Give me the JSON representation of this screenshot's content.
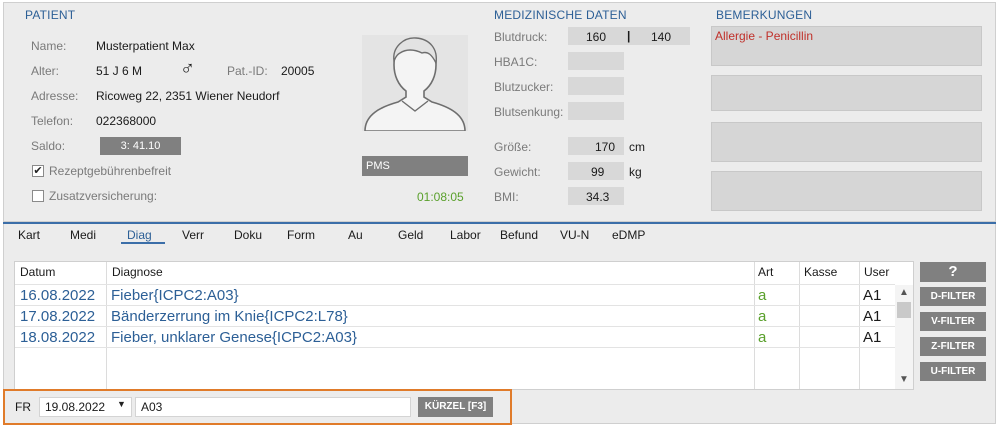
{
  "patient": {
    "section_title": "PATIENT",
    "name_label": "Name:",
    "name_value": "Musterpatient Max",
    "age_label": "Alter:",
    "age_value": "51 J 6 M",
    "gender_symbol": "♂",
    "patid_label": "Pat.-ID:",
    "patid_value": "20005",
    "address_label": "Adresse:",
    "address_value": "Ricoweg 22, 2351 Wiener Neudorf",
    "phone_label": "Telefon:",
    "phone_value": "022368000",
    "saldo_label": "Saldo:",
    "saldo_value": "3: 41.10",
    "rezept_checked": "✔",
    "rezept_label": "Rezeptgebührenbefreit",
    "zusatz_label": "Zusatzversicherung:",
    "pms_label": "PMS",
    "timer": "01:08:05"
  },
  "medical": {
    "section_title": "MEDIZINISCHE DATEN",
    "bp_label": "Blutdruck:",
    "bp_sys": "160",
    "bp_sep": "|",
    "bp_dia": "140",
    "hba1c_label": "HBA1C:",
    "sugar_label": "Blutzucker:",
    "sed_label": "Blutsenkung:",
    "height_label": "Größe:",
    "height_value": "170",
    "height_unit": "cm",
    "weight_label": "Gewicht:",
    "weight_value": "99",
    "weight_unit": "kg",
    "bmi_label": "BMI:",
    "bmi_value": "34.3"
  },
  "remarks": {
    "section_title": "BEMERKUNGEN",
    "box1": "Allergie - Penicillin"
  },
  "tabs": [
    "Kart",
    "Medi",
    "Diag",
    "Verr",
    "Doku",
    "Form",
    "Au",
    "Geld",
    "Labor",
    "Befund",
    "VU-N",
    "eDMP"
  ],
  "active_tab": "Diag",
  "table": {
    "headers": [
      "Datum",
      "Diagnose",
      "Art",
      "Kasse",
      "User"
    ],
    "rows": [
      {
        "date": "16.08.2022",
        "diagnosis": "Fieber{ICPC2:A03}",
        "art": "a",
        "kasse": "",
        "user": "A1"
      },
      {
        "date": "17.08.2022",
        "diagnosis": "Bänderzerrung im Knie{ICPC2:L78}",
        "art": "a",
        "kasse": "",
        "user": "A1"
      },
      {
        "date": "18.08.2022",
        "diagnosis": "Fieber, unklarer Genese{ICPC2:A03}",
        "art": "a",
        "kasse": "",
        "user": "A1"
      }
    ]
  },
  "filters": {
    "help": "?",
    "d": "D-FILTER",
    "v": "V-FILTER",
    "z": "Z-FILTER",
    "u": "U-FILTER"
  },
  "entry": {
    "code": "FR",
    "date_value": "19.08.2022",
    "input_value": "A03",
    "kurzel_label": "KÜRZEL [F3]"
  }
}
